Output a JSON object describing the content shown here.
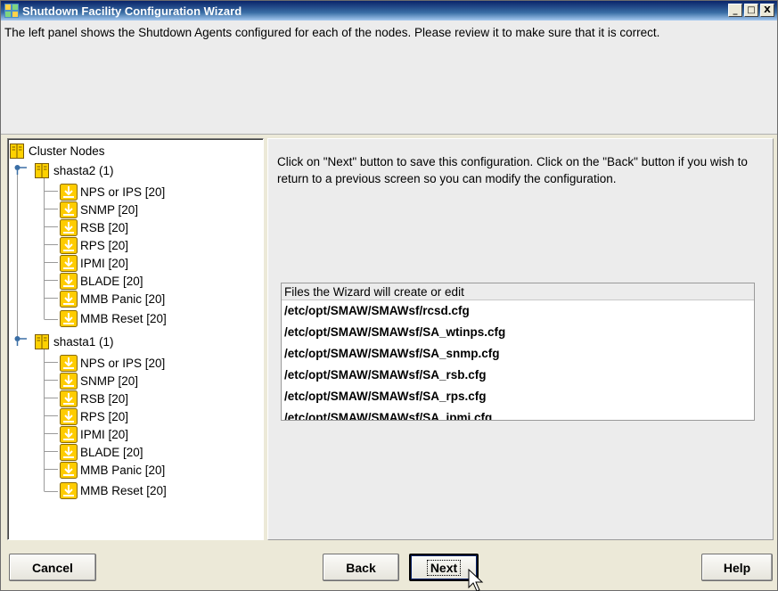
{
  "window": {
    "title": "Shutdown Facility Configuration Wizard",
    "controls": {
      "minimize": "_",
      "maximize": "□",
      "close": "X"
    }
  },
  "description": "The left panel shows the Shutdown Agents configured for each of the nodes. Please review it to make sure that it is correct.",
  "tree": {
    "root_label": "Cluster Nodes",
    "nodes": [
      {
        "label": "shasta2 (1)",
        "agents": [
          "NPS or IPS [20]",
          "SNMP [20]",
          "RSB [20]",
          "RPS [20]",
          "IPMI [20]",
          "BLADE [20]",
          "MMB Panic [20]",
          "MMB Reset [20]"
        ]
      },
      {
        "label": "shasta1 (1)",
        "agents": [
          "NPS or IPS [20]",
          "SNMP [20]",
          "RSB [20]",
          "RPS [20]",
          "IPMI [20]",
          "BLADE [20]",
          "MMB Panic [20]",
          "MMB Reset [20]"
        ]
      }
    ]
  },
  "info_text": "Click on \"Next\" button to save this configuration. Click on the \"Back\" button if you wish to return to a previous screen so you can modify the configuration.",
  "files": {
    "header": "Files the Wizard will create or edit",
    "items": [
      "/etc/opt/SMAW/SMAWsf/rcsd.cfg",
      "/etc/opt/SMAW/SMAWsf/SA_wtinps.cfg",
      "/etc/opt/SMAW/SMAWsf/SA_snmp.cfg",
      "/etc/opt/SMAW/SMAWsf/SA_rsb.cfg",
      "/etc/opt/SMAW/SMAWsf/SA_rps.cfg",
      "/etc/opt/SMAW/SMAWsf/SA_ipmi.cfg"
    ]
  },
  "buttons": {
    "cancel": "Cancel",
    "back": "Back",
    "next": "Next",
    "help": "Help"
  },
  "icons": {
    "app": "wizard-app-icon",
    "tree_root": "book-icon",
    "tree_node": "book-icon",
    "agent": "shutdown-agent-icon",
    "cursor": "mouse-pointer-icon"
  },
  "colors": {
    "titlebar": "#0a246a",
    "window_bg": "#ece9d8",
    "icon_gold": "#e8c000"
  }
}
